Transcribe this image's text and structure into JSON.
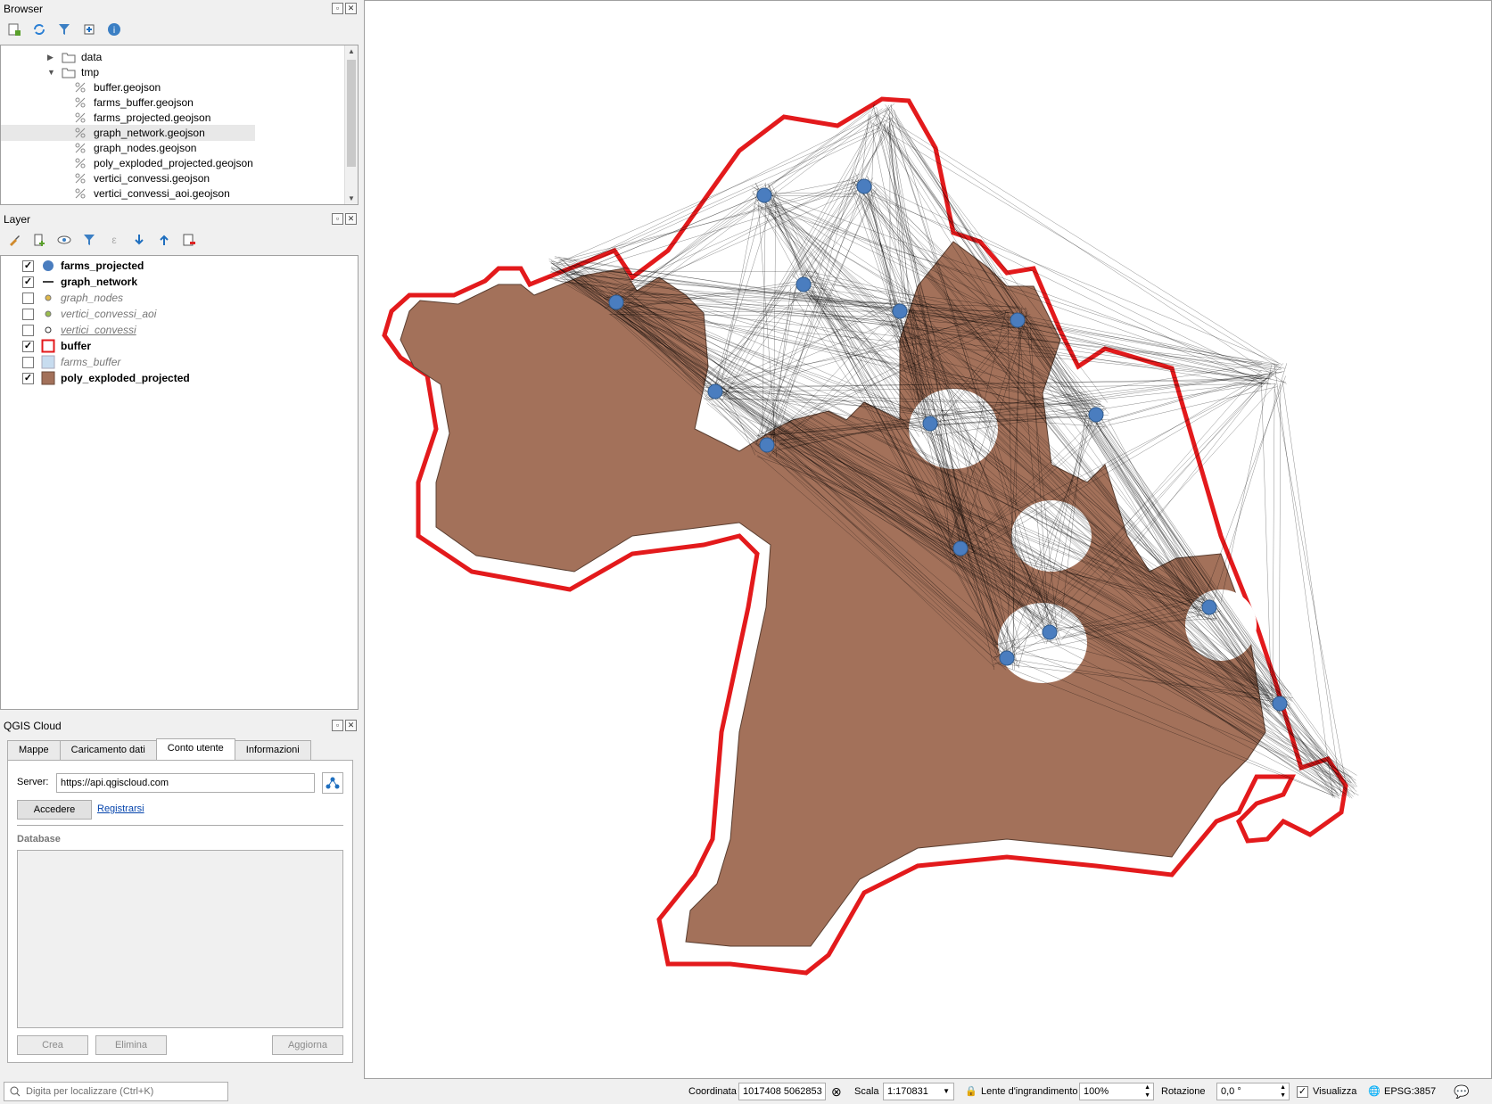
{
  "browser": {
    "title": "Browser",
    "items": [
      {
        "label": "data",
        "type": "folder",
        "expanded": false
      },
      {
        "label": "tmp",
        "type": "folder",
        "expanded": true
      },
      {
        "label": "buffer.geojson",
        "type": "file"
      },
      {
        "label": "farms_buffer.geojson",
        "type": "file"
      },
      {
        "label": "farms_projected.geojson",
        "type": "file"
      },
      {
        "label": "graph_network.geojson",
        "type": "file",
        "selected": true
      },
      {
        "label": "graph_nodes.geojson",
        "type": "file"
      },
      {
        "label": "poly_exploded_projected.geojson",
        "type": "file"
      },
      {
        "label": "vertici_convessi.geojson",
        "type": "file"
      },
      {
        "label": "vertici_convessi_aoi.geojson",
        "type": "file"
      }
    ]
  },
  "layers": {
    "title": "Layer",
    "items": [
      {
        "name": "farms_projected",
        "checked": true,
        "style": "bold",
        "symbol": "blue-dot"
      },
      {
        "name": "graph_network",
        "checked": true,
        "style": "bold",
        "symbol": "line"
      },
      {
        "name": "graph_nodes",
        "checked": false,
        "style": "italic",
        "symbol": "yellow-dot"
      },
      {
        "name": "vertici_convessi_aoi",
        "checked": false,
        "style": "italic",
        "symbol": "green-dot"
      },
      {
        "name": "vertici_convessi",
        "checked": false,
        "style": "italic-underline",
        "symbol": "white-dot"
      },
      {
        "name": "buffer",
        "checked": true,
        "style": "bold",
        "symbol": "red-outline"
      },
      {
        "name": "farms_buffer",
        "checked": false,
        "style": "italic",
        "symbol": "lightblue-fill"
      },
      {
        "name": "poly_exploded_projected",
        "checked": true,
        "style": "bold",
        "symbol": "brown-fill"
      }
    ]
  },
  "cloud": {
    "title": "QGIS Cloud",
    "tabs": [
      "Mappe",
      "Caricamento dati",
      "Conto utente",
      "Informazioni"
    ],
    "active_tab": 2,
    "server_label": "Server:",
    "server_value": "https://api.qgiscloud.com",
    "login_button": "Accedere",
    "register_link": "Registrarsi",
    "database_label": "Database",
    "create_button": "Crea",
    "delete_button": "Elimina",
    "refresh_button": "Aggiorna"
  },
  "status": {
    "search_placeholder": "Digita per localizzare (Ctrl+K)",
    "coord_label": "Coordinata",
    "coord_value": "1017408 5062853",
    "scale_label": "Scala",
    "scale_value": "1:170831",
    "magnifier_label": "Lente d'ingrandimento",
    "magnifier_value": "100%",
    "rotation_label": "Rotazione",
    "rotation_value": "0,0 °",
    "render_label": "Visualizza",
    "render_checked": true,
    "crs": "EPSG:3857"
  },
  "colors": {
    "farm": "#4a7dbf",
    "buffer": "#e31a1c",
    "polygon": "#a3715a",
    "network": "#000000"
  }
}
